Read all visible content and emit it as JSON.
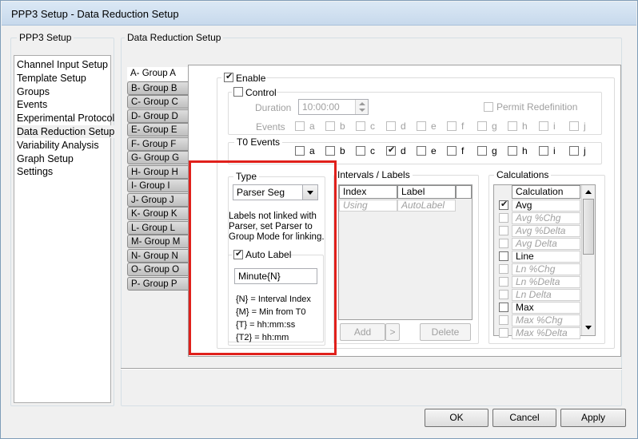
{
  "window": {
    "title": "PPP3 Setup - Data Reduction Setup"
  },
  "left_group": {
    "title": "PPP3 Setup",
    "nav_items": [
      "Channel Input Setup",
      "Template Setup",
      "Groups",
      "Events",
      "Experimental Protocol",
      "Data Reduction Setup",
      "Variability Analysis",
      "Graph Setup",
      "Settings"
    ],
    "selected_index": 5
  },
  "right_group": {
    "title": "Data Reduction Setup"
  },
  "tabs": [
    "A- Group A",
    "B- Group B",
    "C- Group C",
    "D- Group D",
    "E- Group E",
    "F- Group F",
    "G- Group G",
    "H- Group H",
    "I- Group I",
    "J- Group J",
    "K- Group K",
    "L- Group L",
    "M- Group M",
    "N- Group N",
    "O- Group O",
    "P- Group P"
  ],
  "enable": {
    "label": "Enable",
    "checked": true
  },
  "control": {
    "label": "Control",
    "checked": false,
    "duration_label": "Duration",
    "duration_value": "10:00:00",
    "permit_label": "Permit Redefinition",
    "events_label": "Events"
  },
  "event_letters": [
    "a",
    "b",
    "c",
    "d",
    "e",
    "f",
    "g",
    "h",
    "i",
    "j"
  ],
  "t0_events": {
    "label": "T0 Events",
    "checked": [
      "d"
    ]
  },
  "type": {
    "label": "Type",
    "selected": "Parser Seg",
    "note": [
      "Labels not linked with",
      "Parser, set Parser to",
      "Group Mode for linking."
    ]
  },
  "auto_label": {
    "label": "Auto Label",
    "checked": true,
    "value": "Minute{N}",
    "legend": [
      "{N} = Interval Index",
      "{M} = Min from T0",
      "{T} = hh:mm:ss",
      "{T2} = hh:mm"
    ]
  },
  "intervals": {
    "title": "Intervals / Labels",
    "columns": [
      "Index",
      "Label"
    ],
    "row": [
      "Using",
      "AutoLabel"
    ],
    "add_label": "Add",
    "arrow_label": ">",
    "delete_label": "Delete"
  },
  "calculations": {
    "title": "Calculations",
    "header": "Calculation",
    "items": [
      {
        "name": "Avg",
        "checked": true,
        "enabled": true
      },
      {
        "name": "Avg %Chg",
        "checked": false,
        "enabled": false
      },
      {
        "name": "Avg %Delta",
        "checked": false,
        "enabled": false
      },
      {
        "name": "Avg Delta",
        "checked": false,
        "enabled": false
      },
      {
        "name": "Line",
        "checked": false,
        "enabled": true
      },
      {
        "name": "Ln %Chg",
        "checked": false,
        "enabled": false
      },
      {
        "name": "Ln %Delta",
        "checked": false,
        "enabled": false
      },
      {
        "name": "Ln Delta",
        "checked": false,
        "enabled": false
      },
      {
        "name": "Max",
        "checked": false,
        "enabled": true
      },
      {
        "name": "Max %Chg",
        "checked": false,
        "enabled": false
      },
      {
        "name": "Max %Delta",
        "checked": false,
        "enabled": false
      }
    ]
  },
  "buttons": {
    "ok": "OK",
    "cancel": "Cancel",
    "apply": "Apply"
  },
  "colors": {
    "highlight_box": "#e0201b",
    "title_bar": "#c7d9ec"
  }
}
